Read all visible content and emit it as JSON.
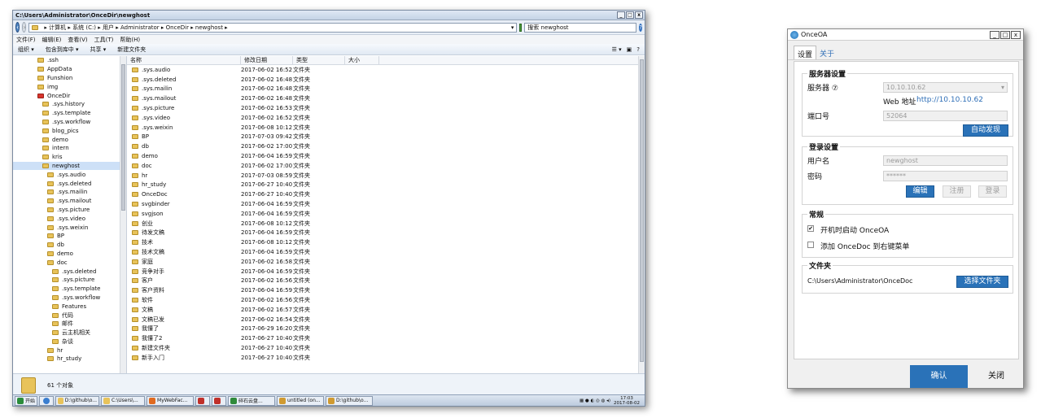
{
  "explorer": {
    "title": "C:\\Users\\Administrator\\OnceDir\\newghost",
    "breadcrumb": "▸ 计算机 ▸ 系统 (C:) ▸ 用户 ▸ Administrator ▸ OnceDir ▸ newghost ▸",
    "search_value": "搜索 newghost",
    "menu": [
      "文件(F)",
      "编辑(E)",
      "查看(V)",
      "工具(T)",
      "帮助(H)"
    ],
    "toolbar": [
      "组织 ▾",
      "包含到库中 ▾",
      "共享 ▾",
      "新建文件夹"
    ],
    "tree": [
      {
        "label": ".ssh",
        "indent": 1
      },
      {
        "label": "AppData",
        "indent": 1
      },
      {
        "label": "Funshion",
        "indent": 1
      },
      {
        "label": "img",
        "indent": 1
      },
      {
        "label": "OnceDir",
        "indent": 1,
        "red": true
      },
      {
        "label": ".sys.history",
        "indent": 2
      },
      {
        "label": ".sys.template",
        "indent": 2
      },
      {
        "label": ".sys.workflow",
        "indent": 2
      },
      {
        "label": "blog_pics",
        "indent": 2
      },
      {
        "label": "demo",
        "indent": 2
      },
      {
        "label": "intern",
        "indent": 2
      },
      {
        "label": "kris",
        "indent": 2
      },
      {
        "label": "newghost",
        "indent": 2,
        "selected": true
      },
      {
        "label": ".sys.audio",
        "indent": 3
      },
      {
        "label": ".sys.deleted",
        "indent": 3
      },
      {
        "label": ".sys.mailin",
        "indent": 3
      },
      {
        "label": ".sys.mailout",
        "indent": 3
      },
      {
        "label": ".sys.picture",
        "indent": 3
      },
      {
        "label": ".sys.video",
        "indent": 3
      },
      {
        "label": ".sys.weixin",
        "indent": 3
      },
      {
        "label": "BP",
        "indent": 3
      },
      {
        "label": "db",
        "indent": 3
      },
      {
        "label": "demo",
        "indent": 3
      },
      {
        "label": "doc",
        "indent": 3
      },
      {
        "label": ".sys.deleted",
        "indent": 4
      },
      {
        "label": ".sys.picture",
        "indent": 4
      },
      {
        "label": ".sys.template",
        "indent": 4
      },
      {
        "label": ".sys.workflow",
        "indent": 4
      },
      {
        "label": "Features",
        "indent": 4
      },
      {
        "label": "代码",
        "indent": 4
      },
      {
        "label": "邮件",
        "indent": 4
      },
      {
        "label": "云主机相关",
        "indent": 4
      },
      {
        "label": "杂谈",
        "indent": 4
      },
      {
        "label": "hr",
        "indent": 3
      },
      {
        "label": "hr_study",
        "indent": 3
      }
    ],
    "columns": [
      "名称",
      "修改日期",
      "类型",
      "大小"
    ],
    "files": [
      [
        ".sys.audio",
        "2017-06-02 16:52",
        "文件夹"
      ],
      [
        ".sys.deleted",
        "2017-06-02 16:48",
        "文件夹"
      ],
      [
        ".sys.mailin",
        "2017-06-02 16:48",
        "文件夹"
      ],
      [
        ".sys.mailout",
        "2017-06-02 16:48",
        "文件夹"
      ],
      [
        ".sys.picture",
        "2017-06-02 16:53",
        "文件夹"
      ],
      [
        ".sys.video",
        "2017-06-02 16:52",
        "文件夹"
      ],
      [
        ".sys.weixin",
        "2017-06-08 10:12",
        "文件夹"
      ],
      [
        "BP",
        "2017-07-03 09:42",
        "文件夹"
      ],
      [
        "db",
        "2017-06-02 17:00",
        "文件夹"
      ],
      [
        "demo",
        "2017-06-04 16:59",
        "文件夹"
      ],
      [
        "doc",
        "2017-06-02 17:00",
        "文件夹"
      ],
      [
        "hr",
        "2017-07-03 08:59",
        "文件夹"
      ],
      [
        "hr_study",
        "2017-06-27 10:40",
        "文件夹"
      ],
      [
        "OnceDoc",
        "2017-06-27 10:40",
        "文件夹"
      ],
      [
        "svgbinder",
        "2017-06-04 16:59",
        "文件夹"
      ],
      [
        "svgjson",
        "2017-06-04 16:59",
        "文件夹"
      ],
      [
        "创业",
        "2017-06-08 10:12",
        "文件夹"
      ],
      [
        "待发文稿",
        "2017-06-04 16:59",
        "文件夹"
      ],
      [
        "技术",
        "2017-06-08 10:12",
        "文件夹"
      ],
      [
        "技术文稿",
        "2017-06-04 16:59",
        "文件夹"
      ],
      [
        "家庭",
        "2017-06-02 16:58",
        "文件夹"
      ],
      [
        "竞争对手",
        "2017-06-04 16:59",
        "文件夹"
      ],
      [
        "客户",
        "2017-06-02 16:56",
        "文件夹"
      ],
      [
        "客户资料",
        "2017-06-04 16:59",
        "文件夹"
      ],
      [
        "软件",
        "2017-06-02 16:56",
        "文件夹"
      ],
      [
        "文稿",
        "2017-06-02 16:57",
        "文件夹"
      ],
      [
        "文稿已发",
        "2017-06-02 16:54",
        "文件夹"
      ],
      [
        "我懂了",
        "2017-06-29 16:20",
        "文件夹"
      ],
      [
        "我懂了2",
        "2017-06-27 10:40",
        "文件夹"
      ],
      [
        "新建文件夹",
        "2017-06-27 10:40",
        "文件夹"
      ],
      [
        "新手入门",
        "2017-06-27 10:40",
        "文件夹"
      ]
    ],
    "status": "61 个对象",
    "taskbar": {
      "start": "开始",
      "items": [
        "D:\\github\\o...",
        "C:\\Users\\...",
        "MyWebFac...",
        "",
        "",
        "碎石云盘...",
        "untitled (on...",
        "D:\\github\\o..."
      ],
      "time": "17:03",
      "date": "2017-08-02"
    }
  },
  "dialog": {
    "title": "OnceOA",
    "tabs": [
      "设置",
      "关于"
    ],
    "server_group": "服务器设置",
    "server_label": "服务器 ⑦",
    "server_value": "10.10.10.62",
    "web_prefix": "Web 地址",
    "web_link": "http://10.10.10.62",
    "port_label": "端口号",
    "port_value": "52064",
    "auto_discover": "自动发现",
    "login_group": "登录设置",
    "username_label": "用户名",
    "username_value": "newghost",
    "password_label": "密码",
    "password_value": "******",
    "edit_btn": "编辑",
    "register_btn": "注册",
    "login_btn": "登录",
    "general_group": "常规",
    "autostart_label": "开机时启动 OnceOA",
    "autostart_checked": true,
    "context_menu_label": "添加 OnceDoc 到右键菜单",
    "context_menu_checked": false,
    "folder_group": "文件夹",
    "folder_path": "C:\\Users\\Administrator\\OnceDoc",
    "choose_folder": "选择文件夹",
    "ok": "确认",
    "close": "关闭"
  }
}
